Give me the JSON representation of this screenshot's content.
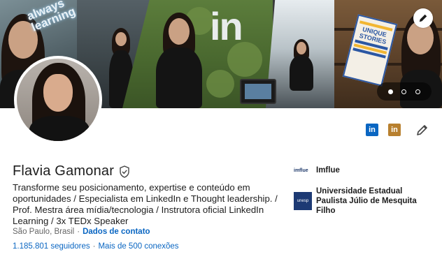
{
  "banner": {
    "neon_text": "always learning",
    "book_title_1": "UNIQUE",
    "book_title_2": "STORIES",
    "carousel": {
      "count": 3,
      "active_index": 0
    }
  },
  "actions": {
    "icon1_text": "in",
    "icon2_text": "in"
  },
  "profile": {
    "name": "Flavia Gamonar",
    "headline": "Transforme seu posicionamento, expertise e conteúdo em oportunidades / Especialista em LinkedIn e Thought leadership. / Prof. Mestra área mídia/tecnologia / Instrutora oficial LinkedIn Learning / 3x TEDx Speaker",
    "location": "São Paulo, Brasil",
    "separator": "·",
    "contact_link": "Dados de contato",
    "followers": "1.185.801 seguidores",
    "connections": "Mais de 500 conexões"
  },
  "organizations": [
    {
      "logo_text": "imflue",
      "name": "Imflue"
    },
    {
      "logo_text": "unesp",
      "name": "Universidade Estadual Paulista Júlio de Mesquita Filho"
    }
  ],
  "colors": {
    "link": "#0a66c2",
    "text": "#1d1d1d",
    "muted": "#666666"
  }
}
